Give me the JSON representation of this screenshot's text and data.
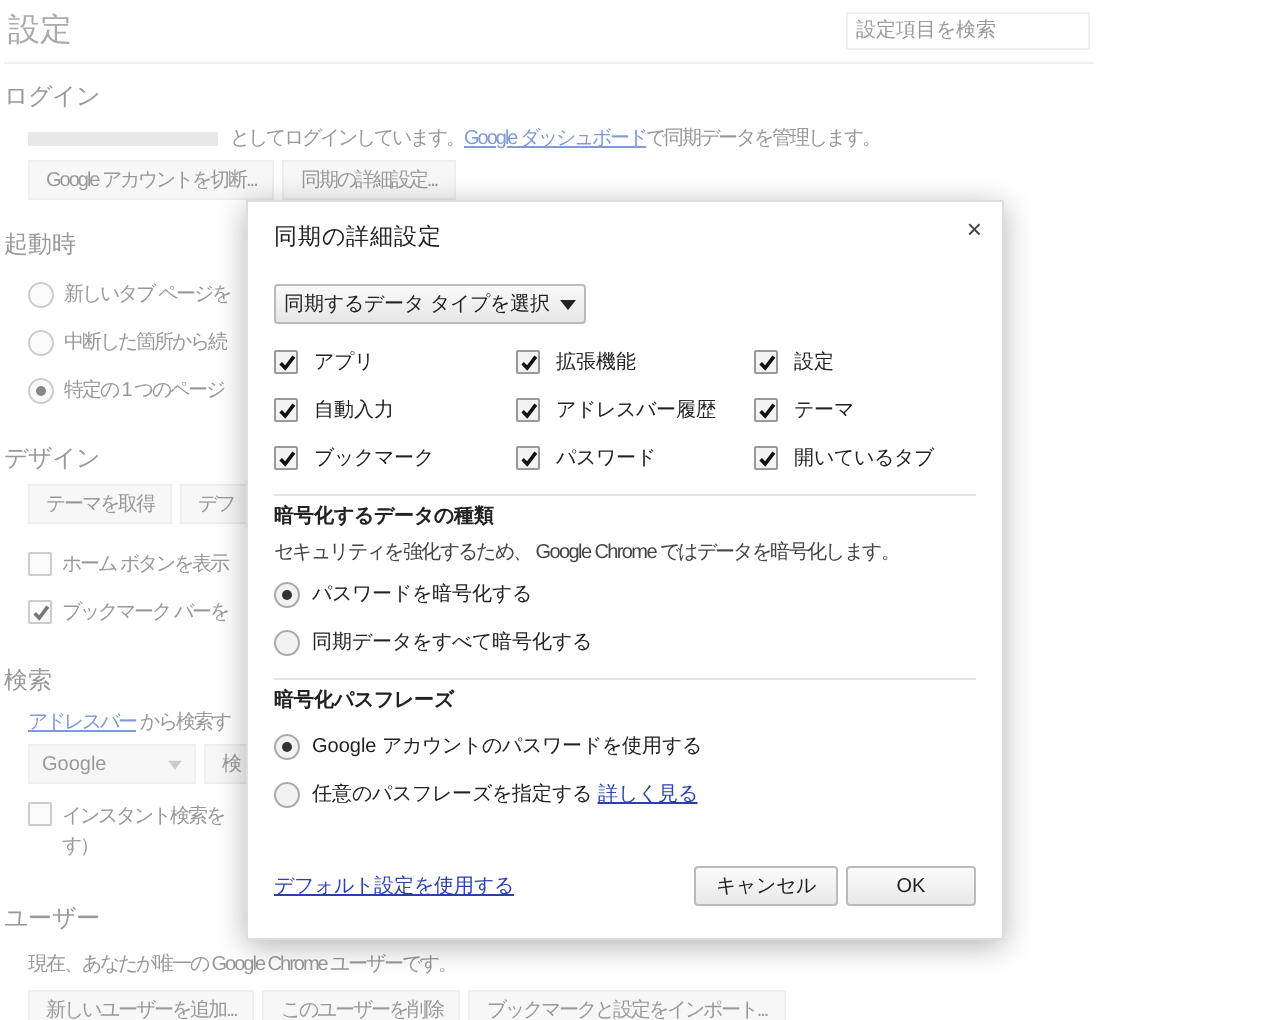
{
  "page": {
    "title": "設定",
    "search": {
      "placeholder": "設定項目を検索"
    },
    "sections": [
      {
        "heading": "ログイン",
        "items": [
          {
            "kind": "account_line",
            "before": "としてログインしています。",
            "link": "Google ダッシュボード",
            "after": "で同期データを管理します。"
          },
          {
            "kind": "buttons",
            "buttons": [
              "Google アカウントを切断...",
              "同期の詳細設定..."
            ]
          }
        ]
      },
      {
        "heading": "起動時",
        "items": [
          {
            "kind": "radio",
            "label": "新しいタブ ページを",
            "selected": false
          },
          {
            "kind": "radio",
            "label": "中断した箇所から続",
            "selected": false
          },
          {
            "kind": "radio",
            "label": "特定の 1 つのページ",
            "selected": true
          }
        ]
      },
      {
        "heading": "デザイン",
        "items": [
          {
            "kind": "buttons",
            "buttons": [
              "テーマを取得",
              "デフ"
            ]
          },
          {
            "kind": "checkbox",
            "label_lines": [
              "ホーム ボタンを表示"
            ],
            "checked": false
          },
          {
            "kind": "checkbox",
            "label_lines": [
              "ブックマーク バーを"
            ],
            "checked": true
          }
        ]
      },
      {
        "heading": "検索",
        "items": [
          {
            "kind": "link_line",
            "link": "アドレスバー",
            "after": " から検索す"
          },
          {
            "kind": "select_row",
            "select": "Google",
            "buttons": [
              "検"
            ]
          },
          {
            "kind": "checkbox",
            "label_lines": [
              "インスタント検索を",
              "す）"
            ],
            "checked": false
          }
        ]
      },
      {
        "heading": "ユーザー",
        "items": [
          {
            "kind": "text",
            "text": "現在、あなたが唯一の Google Chrome ユーザーです。"
          },
          {
            "kind": "buttons",
            "buttons": [
              "新しいユーザーを追加...",
              "このユーザーを削除",
              "ブックマークと設定をインポート..."
            ]
          }
        ]
      }
    ]
  },
  "dialog": {
    "title": "同期の詳細設定",
    "close": "×",
    "dropdown": "同期するデータ タイプを選択",
    "data_types": [
      {
        "label": "アプリ",
        "checked": true
      },
      {
        "label": "拡張機能",
        "checked": true
      },
      {
        "label": "設定",
        "checked": true
      },
      {
        "label": "自動入力",
        "checked": true
      },
      {
        "label": "アドレスバー履歴",
        "checked": true
      },
      {
        "label": "テーマ",
        "checked": true
      },
      {
        "label": "ブックマーク",
        "checked": true
      },
      {
        "label": "パスワード",
        "checked": true
      },
      {
        "label": "開いているタブ",
        "checked": true
      }
    ],
    "encryption": {
      "heading": "暗号化するデータの種類",
      "description": "セキュリティを強化するため、 Google Chrome ではデータを暗号化します。",
      "options": [
        {
          "label": "パスワードを暗号化する",
          "selected": true
        },
        {
          "label": "同期データをすべて暗号化する",
          "selected": false
        }
      ]
    },
    "passphrase": {
      "heading": "暗号化パスフレーズ",
      "options": [
        {
          "label": "Google アカウントのパスワードを使用する",
          "selected": true
        },
        {
          "label": "任意のパスフレーズを指定する",
          "link": "詳しく見る",
          "selected": false
        }
      ]
    },
    "footer_link": "デフォルト設定を使用する",
    "buttons": [
      "キャンセル",
      "OK"
    ]
  }
}
